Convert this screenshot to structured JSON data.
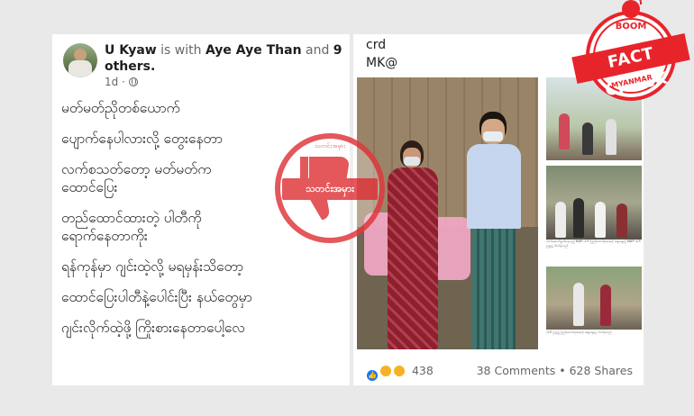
{
  "left_post": {
    "author": "U Kyaw",
    "with_text": "is with",
    "tagged": "Aye Aye Than",
    "and_text": "and",
    "others_count": "9",
    "others_label": "others.",
    "time": "1d",
    "lines": [
      "မတ်မတ်ညိုတစ်ယောက်",
      "ပျောက်နေပါလားလို့ တွေးနေတာ",
      "လက်စသတ်တော့ မတ်မတ်က",
      "ထောင်ပြေး",
      "တည်ထောင်ထားတဲ့ ပါတီကို",
      "ရောက်နေတာကိုး",
      "ရန်ကုန်မှာ ဂျင်းထဲ့လို့ မရမှန်းသိတော့",
      "ထောင်ပြေးပါတီနဲ့ပေါင်းပြီး နယ်တွေမှာ",
      "ဂျင်းလိုက်ထဲ့ဖို့ ကြိုးစားနေတာပေါ့လေ"
    ]
  },
  "right_post": {
    "caption_line1": "crd",
    "caption_line2": "MK@",
    "thumb_caption1": "ပါဝင်ဆောင်ရွက်နေသည့် NUP ပါတီ ပြည်ထောင်စုအဆင့် ဆွေးနွေးပွဲ NUP ပါတီ ဥက္ကဋ္ဌ ပါဝင်ခဲ့သည်",
    "thumb_caption2": "ပါတီ ဥက္ကဋ္ဌ ပြည်ထောင်စုအဆင့် ဆွေးနွေးပွဲ ပါဝင်ခဲ့သည်",
    "reaction_count": "438",
    "comments": "38 Comments",
    "separator": "•",
    "shares": "628 Shares"
  },
  "badge": {
    "boom": "BOOM",
    "title": "FACT CHECK",
    "subtitle": "MYANMAR",
    "color": "#e8242b"
  },
  "stamp": {
    "label": "သတင်းအမှား",
    "arc_text": "သတင်းအမှား",
    "color": "#e03a3e"
  }
}
